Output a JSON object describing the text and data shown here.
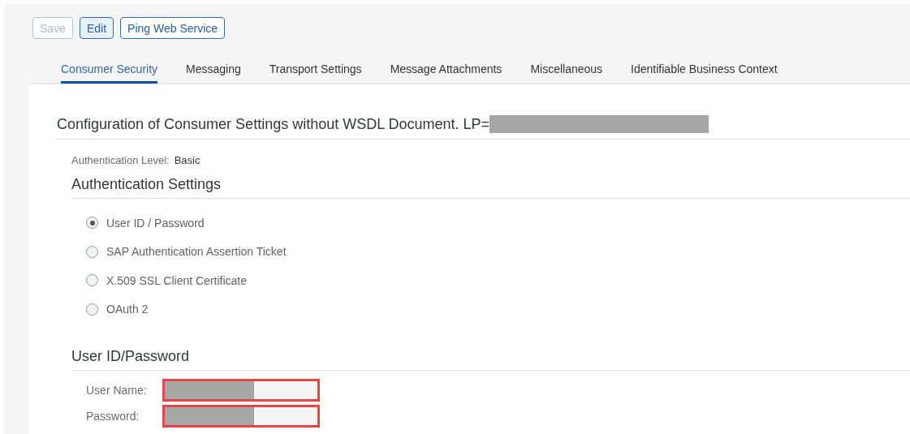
{
  "toolbar": {
    "buttons": [
      {
        "label": "Save",
        "disabled": true,
        "pressed": false
      },
      {
        "label": "Edit",
        "disabled": false,
        "pressed": true
      },
      {
        "label": "Ping Web Service",
        "disabled": false,
        "pressed": false
      }
    ]
  },
  "tabs": [
    {
      "label": "Consumer Security",
      "selected": true
    },
    {
      "label": "Messaging",
      "selected": false
    },
    {
      "label": "Transport Settings",
      "selected": false
    },
    {
      "label": "Message Attachments",
      "selected": false
    },
    {
      "label": "Miscellaneous",
      "selected": false
    },
    {
      "label": "Identifiable Business Context",
      "selected": false
    }
  ],
  "page_title": {
    "text": "Configuration of Consumer Settings without WSDL Document. LP=",
    "redacted": true
  },
  "authentication_level": {
    "label": "Authentication Level:",
    "value": "Basic"
  },
  "authentication_settings": {
    "heading": "Authentication Settings",
    "options": [
      {
        "label": "User ID / Password",
        "selected": true
      },
      {
        "label": "SAP Authentication Assertion Ticket",
        "selected": false
      },
      {
        "label": "X.509 SSL Client Certificate",
        "selected": false
      },
      {
        "label": "OAuth 2",
        "selected": false
      }
    ]
  },
  "credentials": {
    "heading": "User ID/Password",
    "fields": [
      {
        "label": "User Name:",
        "redacted": true,
        "highlighted": true
      },
      {
        "label": "Password:",
        "redacted": true,
        "highlighted": true
      }
    ]
  }
}
